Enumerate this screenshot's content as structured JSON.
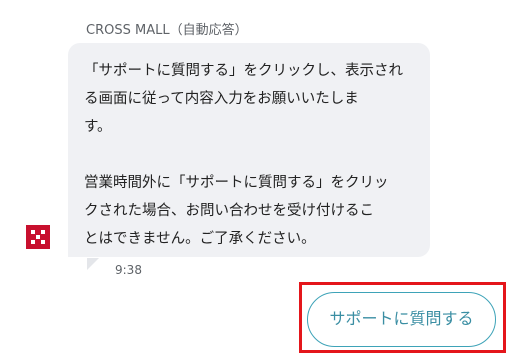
{
  "chat": {
    "sender_name": "CROSS MALL（自動応答）",
    "message_lines": [
      "「サポートに質問する」をクリックし、表示され",
      "る画面に従って内容入力をお願いいたしま",
      "す。",
      "",
      "営業時間外に「サポートに質問する」をクリッ",
      "クされた場合、お問い合わせを受け付けるこ",
      "とはできません。ご了承ください。"
    ],
    "timestamp": "9:38",
    "avatar_icon": "cross-mall-logo-icon",
    "avatar_color": "#c8102e"
  },
  "actions": {
    "support_button_label": "サポートに質問する",
    "highlight_color": "#e4161b",
    "button_accent_color": "#3ea3b8"
  }
}
